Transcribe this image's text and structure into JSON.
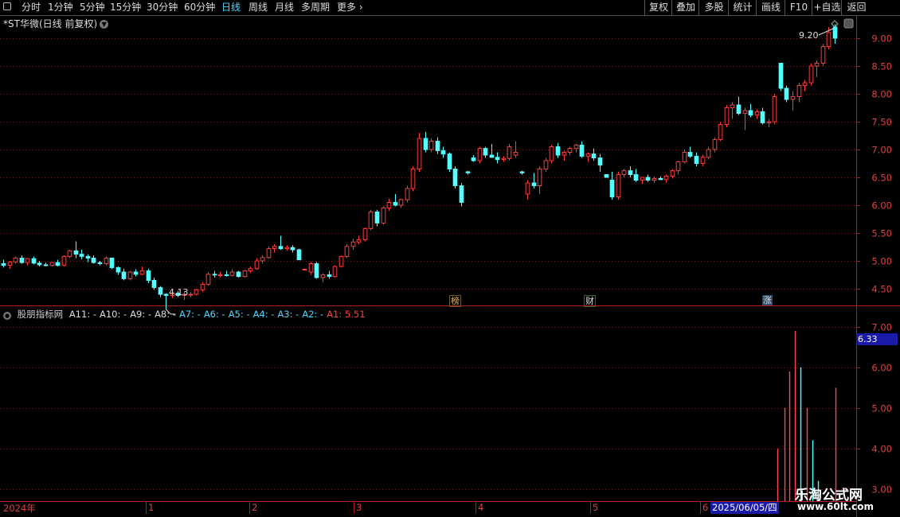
{
  "toolbar": {
    "periods": [
      "分时",
      "1分钟",
      "5分钟",
      "15分钟",
      "30分钟",
      "60分钟",
      "日线",
      "周线",
      "月线",
      "多周期",
      "更多"
    ],
    "active_period": "日线",
    "right_buttons": [
      "复权",
      "叠加",
      "多股",
      "统计",
      "画线",
      "F10",
      "+自选",
      "返回"
    ]
  },
  "main": {
    "title": "*ST华微(日线 前复权)",
    "y_ticks": [
      "9.00",
      "8.50",
      "8.00",
      "7.50",
      "7.00",
      "6.50",
      "6.00",
      "5.50",
      "5.00",
      "4.50"
    ],
    "high_label": "9.20",
    "low_label": "4.13",
    "events": [
      "榜",
      "财",
      "涨"
    ]
  },
  "indicator": {
    "name": "股朋指标网",
    "items": [
      {
        "label": "A11:",
        "value": "-"
      },
      {
        "label": "A10:",
        "value": "-"
      },
      {
        "label": "A9:",
        "value": "-"
      },
      {
        "label": "A8:",
        "value": "-"
      },
      {
        "label": "A7:",
        "value": "-"
      },
      {
        "label": "A6:",
        "value": "-"
      },
      {
        "label": "A5:",
        "value": "-"
      },
      {
        "label": "A4:",
        "value": "-"
      },
      {
        "label": "A3:",
        "value": "-"
      },
      {
        "label": "A2:",
        "value": "-"
      },
      {
        "label": "A1:",
        "value": "5.51"
      }
    ],
    "y_ticks": [
      "7.00",
      "6.00",
      "5.00",
      "4.00",
      "3.00"
    ],
    "highlight_value": "6.33"
  },
  "x_axis": {
    "labels": [
      "2024年",
      "1",
      "2",
      "3",
      "4",
      "5",
      "6"
    ],
    "selected_date": "2025/06/05/四"
  },
  "watermark": {
    "line1": "乐淘公式网",
    "line2": "www.60lt.com"
  },
  "chart_data": {
    "type": "candlestick",
    "title": "*ST华微(日线 前复权)",
    "ylim": [
      4.2,
      9.4
    ],
    "y_ticks": [
      4.5,
      5.0,
      5.5,
      6.0,
      6.5,
      7.0,
      7.5,
      8.0,
      8.5,
      9.0
    ],
    "high_marker": 9.2,
    "low_marker": 4.13,
    "candles_ohlc": [
      [
        4.95,
        5.02,
        4.88,
        4.92
      ],
      [
        4.92,
        5.0,
        4.86,
        4.98
      ],
      [
        4.98,
        5.08,
        4.95,
        5.05
      ],
      [
        5.05,
        5.1,
        4.95,
        4.97
      ],
      [
        4.97,
        5.05,
        4.92,
        5.04
      ],
      [
        5.04,
        5.08,
        4.94,
        4.96
      ],
      [
        4.96,
        5.0,
        4.9,
        4.93
      ],
      [
        4.93,
        4.97,
        4.9,
        4.92
      ],
      [
        4.92,
        4.98,
        4.9,
        4.97
      ],
      [
        4.97,
        5.02,
        4.9,
        4.92
      ],
      [
        4.92,
        5.1,
        4.9,
        5.08
      ],
      [
        5.08,
        5.2,
        5.05,
        5.18
      ],
      [
        5.18,
        5.35,
        5.05,
        5.12
      ],
      [
        5.12,
        5.2,
        5.03,
        5.08
      ],
      [
        5.08,
        5.12,
        4.98,
        5.05
      ],
      [
        5.05,
        5.1,
        4.95,
        4.97
      ],
      [
        4.97,
        5.0,
        4.92,
        4.95
      ],
      [
        4.95,
        5.08,
        4.92,
        5.05
      ],
      [
        5.05,
        5.06,
        4.85,
        4.88
      ],
      [
        4.88,
        4.9,
        4.75,
        4.8
      ],
      [
        4.8,
        4.86,
        4.65,
        4.68
      ],
      [
        4.68,
        4.82,
        4.65,
        4.8
      ],
      [
        4.8,
        4.85,
        4.72,
        4.76
      ],
      [
        4.76,
        4.9,
        4.74,
        4.82
      ],
      [
        4.82,
        4.86,
        4.6,
        4.65
      ],
      [
        4.65,
        4.7,
        4.48,
        4.52
      ],
      [
        4.52,
        4.55,
        4.35,
        4.4
      ],
      [
        4.4,
        4.42,
        4.13,
        4.38
      ],
      [
        4.38,
        4.46,
        4.33,
        4.42
      ],
      [
        4.42,
        4.46,
        4.35,
        4.38
      ],
      [
        4.38,
        4.45,
        4.3,
        4.4
      ],
      [
        4.4,
        4.44,
        4.35,
        4.4
      ],
      [
        4.4,
        4.5,
        4.38,
        4.48
      ],
      [
        4.48,
        4.62,
        4.44,
        4.58
      ],
      [
        4.58,
        4.8,
        4.55,
        4.76
      ],
      [
        4.76,
        4.82,
        4.7,
        4.75
      ],
      [
        4.75,
        4.8,
        4.7,
        4.75
      ],
      [
        4.75,
        4.82,
        4.72,
        4.74
      ],
      [
        4.74,
        4.85,
        4.72,
        4.8
      ],
      [
        4.8,
        4.82,
        4.7,
        4.72
      ],
      [
        4.72,
        4.84,
        4.7,
        4.82
      ],
      [
        4.82,
        4.9,
        4.78,
        4.86
      ],
      [
        4.86,
        5.05,
        4.84,
        5.0
      ],
      [
        5.0,
        5.1,
        4.95,
        5.06
      ],
      [
        5.06,
        5.26,
        5.04,
        5.22
      ],
      [
        5.22,
        5.3,
        5.15,
        5.26
      ],
      [
        5.26,
        5.45,
        5.2,
        5.22
      ],
      [
        5.22,
        5.28,
        5.18,
        5.24
      ],
      [
        5.24,
        5.28,
        5.15,
        5.2
      ],
      [
        5.2,
        5.22,
        5.02,
        5.02
      ],
      [
        4.85,
        4.85,
        4.85,
        4.85
      ],
      [
        4.8,
        4.98,
        4.75,
        4.95
      ],
      [
        4.95,
        4.98,
        4.68,
        4.7
      ],
      [
        4.7,
        4.78,
        4.62,
        4.75
      ],
      [
        4.75,
        4.82,
        4.68,
        4.72
      ],
      [
        4.72,
        4.92,
        4.7,
        4.9
      ],
      [
        4.9,
        5.1,
        4.88,
        5.08
      ],
      [
        5.08,
        5.3,
        5.05,
        5.26
      ],
      [
        5.26,
        5.4,
        5.2,
        5.34
      ],
      [
        5.34,
        5.45,
        5.3,
        5.38
      ],
      [
        5.38,
        5.6,
        5.35,
        5.58
      ],
      [
        5.58,
        5.92,
        5.55,
        5.88
      ],
      [
        5.88,
        5.92,
        5.62,
        5.68
      ],
      [
        5.68,
        5.98,
        5.65,
        5.95
      ],
      [
        5.95,
        6.12,
        5.9,
        6.05
      ],
      [
        6.05,
        6.2,
        5.98,
        6.0
      ],
      [
        6.0,
        6.12,
        5.95,
        6.1
      ],
      [
        6.1,
        6.35,
        6.05,
        6.3
      ],
      [
        6.3,
        6.7,
        6.25,
        6.65
      ],
      [
        6.65,
        7.3,
        6.6,
        7.2
      ],
      [
        7.2,
        7.32,
        6.95,
        7.0
      ],
      [
        7.0,
        7.2,
        6.95,
        7.15
      ],
      [
        7.15,
        7.22,
        6.92,
        6.98
      ],
      [
        6.98,
        7.05,
        6.85,
        6.92
      ],
      [
        6.92,
        6.95,
        6.6,
        6.65
      ],
      [
        6.65,
        6.7,
        6.3,
        6.35
      ],
      [
        6.35,
        6.4,
        5.98,
        6.05
      ],
      [
        6.6,
        6.62,
        6.55,
        6.58
      ],
      [
        6.85,
        6.9,
        6.78,
        6.8
      ],
      [
        6.8,
        7.05,
        6.75,
        7.02
      ],
      [
        7.02,
        7.05,
        6.85,
        6.9
      ],
      [
        6.9,
        7.1,
        6.85,
        6.86
      ],
      [
        6.86,
        6.95,
        6.75,
        6.82
      ],
      [
        6.82,
        6.88,
        6.78,
        6.84
      ],
      [
        6.84,
        7.1,
        6.8,
        7.05
      ],
      [
        6.9,
        7.15,
        6.85,
        6.95
      ],
      [
        6.6,
        6.62,
        6.55,
        6.58
      ],
      [
        6.2,
        6.45,
        6.1,
        6.4
      ],
      [
        6.4,
        6.58,
        6.3,
        6.35
      ],
      [
        6.35,
        6.7,
        6.2,
        6.65
      ],
      [
        6.65,
        6.85,
        6.6,
        6.8
      ],
      [
        6.8,
        7.08,
        6.75,
        7.05
      ],
      [
        7.05,
        7.12,
        6.85,
        6.9
      ],
      [
        6.9,
        6.98,
        6.8,
        6.95
      ],
      [
        6.95,
        7.05,
        6.9,
        7.02
      ],
      [
        7.02,
        7.1,
        6.95,
        7.08
      ],
      [
        7.08,
        7.15,
        6.85,
        6.88
      ],
      [
        6.88,
        6.95,
        6.78,
        6.92
      ],
      [
        6.92,
        7.02,
        6.8,
        6.85
      ],
      [
        6.85,
        6.92,
        6.6,
        6.72
      ],
      [
        6.55,
        6.55,
        6.5,
        6.5
      ],
      [
        6.45,
        6.6,
        6.1,
        6.15
      ],
      [
        6.15,
        6.6,
        6.1,
        6.55
      ],
      [
        6.55,
        6.65,
        6.5,
        6.62
      ],
      [
        6.62,
        6.7,
        6.5,
        6.55
      ],
      [
        6.55,
        6.65,
        6.42,
        6.45
      ],
      [
        6.45,
        6.5,
        6.38,
        6.5
      ],
      [
        6.5,
        6.55,
        6.42,
        6.45
      ],
      [
        6.45,
        6.52,
        6.4,
        6.48
      ],
      [
        6.48,
        6.52,
        6.45,
        6.46
      ],
      [
        6.46,
        6.55,
        6.4,
        6.52
      ],
      [
        6.52,
        6.65,
        6.48,
        6.62
      ],
      [
        6.62,
        6.8,
        6.55,
        6.78
      ],
      [
        6.78,
        7.0,
        6.75,
        6.95
      ],
      [
        6.95,
        7.05,
        6.85,
        6.88
      ],
      [
        6.88,
        6.95,
        6.7,
        6.75
      ],
      [
        6.75,
        6.9,
        6.7,
        6.86
      ],
      [
        6.86,
        7.05,
        6.82,
        7.0
      ],
      [
        7.0,
        7.22,
        6.95,
        7.18
      ],
      [
        7.18,
        7.5,
        7.15,
        7.45
      ],
      [
        7.45,
        7.8,
        7.4,
        7.75
      ],
      [
        7.75,
        7.85,
        7.55,
        7.8
      ],
      [
        7.8,
        7.95,
        7.62,
        7.65
      ],
      [
        7.65,
        7.75,
        7.35,
        7.7
      ],
      [
        7.7,
        7.82,
        7.58,
        7.62
      ],
      [
        7.62,
        7.72,
        7.55,
        7.68
      ],
      [
        7.68,
        7.75,
        7.45,
        7.48
      ],
      [
        7.48,
        7.55,
        7.4,
        7.5
      ],
      [
        7.5,
        8.0,
        7.45,
        7.95
      ],
      [
        8.55,
        8.55,
        8.05,
        8.1
      ],
      [
        8.1,
        8.15,
        7.85,
        7.9
      ],
      [
        7.9,
        8.05,
        7.7,
        7.95
      ],
      [
        7.95,
        8.2,
        7.85,
        8.15
      ],
      [
        8.15,
        8.25,
        8.05,
        8.2
      ],
      [
        8.2,
        8.55,
        8.15,
        8.5
      ],
      [
        8.5,
        8.6,
        8.3,
        8.55
      ],
      [
        8.55,
        8.9,
        8.5,
        8.85
      ],
      [
        8.85,
        9.2,
        8.8,
        9.1
      ],
      [
        9.2,
        9.25,
        8.9,
        9.0
      ]
    ],
    "indicator_bars": [
      {
        "color": "red",
        "value": 4.0
      },
      {
        "color": "red",
        "value": 5.0
      },
      {
        "color": "red",
        "value": 5.9
      },
      {
        "color": "red",
        "value": 6.9
      },
      {
        "color": "cyan",
        "value": 6.0
      },
      {
        "color": "red",
        "value": 5.0
      },
      {
        "color": "cyan",
        "value": 4.2
      },
      {
        "color": "cyan",
        "value": 3.2
      },
      {
        "color": "red",
        "value": 5.5
      }
    ],
    "indicator_ylim": [
      2.7,
      7.45
    ]
  }
}
